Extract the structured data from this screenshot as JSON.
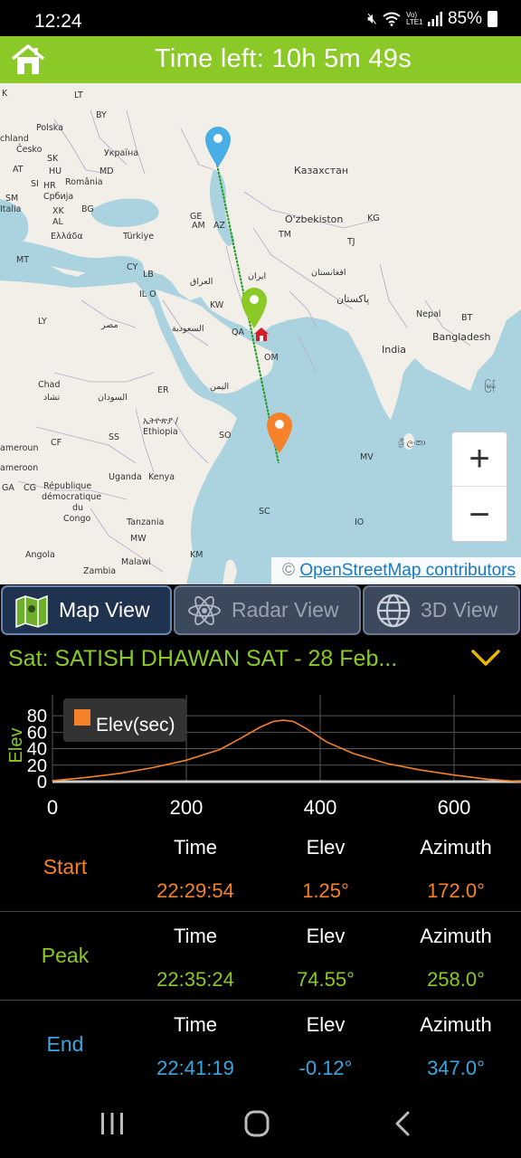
{
  "status": {
    "time": "12:24",
    "signal_label": "Vo) LTE1",
    "battery": "85%"
  },
  "header": {
    "title": "Time left: 10h 5m 49s",
    "home_icon": "home-icon"
  },
  "map": {
    "labels": {
      "polska": "Polska",
      "chland": "chland",
      "cesko": "Česko",
      "sk": "SK",
      "ukraina": "Україна",
      "at": "AT",
      "hu": "HU",
      "md": "MD",
      "si": "SI",
      "hr": "HR",
      "romania": "România",
      "sm": "SM",
      "srbija": "Србија",
      "italia": "Italia",
      "xk": "XK",
      "bg": "BG",
      "al": "AL",
      "ellada": "Ελλάδα",
      "turkiye": "Türkiye",
      "mt": "MT",
      "cy": "CY",
      "lb": "LB",
      "ilo": "IL O",
      "ly": "LY",
      "misr": "مصر",
      "ge": "GE",
      "am": "AM",
      "az": "AZ",
      "kazakhstan": "Казахстан",
      "uzbekiston": "O'zbekiston",
      "kg": "KG",
      "tm": "TM",
      "tj": "TJ",
      "iran": "ایران",
      "iraq": "العراق",
      "afghanistan": "افغانستان",
      "pakistan": "پاکستان",
      "kw": "KW",
      "saudi": "السعودية",
      "qa": "QA",
      "om": "OM",
      "nepal": "Nepal",
      "bt": "BT",
      "bangladesh": "Bangladesh",
      "india": "India",
      "myanmar": "မြန်",
      "lk": "ශ්‍රී ලංකා",
      "chad": "Chad",
      "tchad": "تشاد",
      "sudan": "السودان",
      "er": "ER",
      "yemen": "اليمن",
      "ethiopia_am": "ኢትዮጵያ /",
      "ethiopia": "Ethiopia",
      "so": "SO",
      "ss": "SS",
      "cf": "CF",
      "cameroun": "ameroun",
      "cameroon": "ameroon",
      "ga": "GA",
      "cg": "CG",
      "rdc1": "République",
      "rdc2": "démocratique",
      "rdc3": "du",
      "rdc4": "Congo",
      "uganda": "Uganda",
      "kenya": "Kenya",
      "tanzania": "Tanzania",
      "angola": "Angola",
      "zambia": "Zambia",
      "malawi": "Malawi",
      "mw": "MW",
      "km": "KM",
      "mv": "MV",
      "sc": "SC",
      "io": "IO",
      "by": "BY",
      "lt": "LT",
      "dk": "K"
    },
    "zoom_in": "+",
    "zoom_out": "−",
    "attribution_prefix": "©",
    "attribution_link": "OpenStreetMap contributors"
  },
  "tabs": [
    {
      "label": "Map View",
      "icon": "map-icon",
      "active": true
    },
    {
      "label": "Radar View",
      "icon": "atom-icon",
      "active": false
    },
    {
      "label": "3D View",
      "icon": "globe-icon",
      "active": false
    }
  ],
  "satellite": {
    "label": "Sat: SATISH DHAWAN SAT - 28 Feb..."
  },
  "chart_data": {
    "type": "line",
    "title": "",
    "xlabel": "",
    "ylabel": "Elev",
    "x_ticks": [
      "0",
      "200",
      "400",
      "600"
    ],
    "y_ticks": [
      "0",
      "20",
      "40",
      "60",
      "80"
    ],
    "xlim": [
      0,
      700
    ],
    "ylim": [
      0,
      90
    ],
    "legend_position": "top-left",
    "series": [
      {
        "name": "Elev(sec)",
        "color": "#f5822a",
        "x": [
          0,
          50,
          100,
          150,
          200,
          250,
          280,
          310,
          330,
          345,
          360,
          380,
          410,
          450,
          500,
          550,
          600,
          650,
          700
        ],
        "y": [
          1.25,
          5,
          10,
          17,
          26,
          39,
          52,
          66,
          73,
          74.55,
          73,
          64,
          48,
          34,
          22,
          14,
          8,
          3,
          -0.12
        ]
      }
    ]
  },
  "pass_table": {
    "headers": {
      "time": "Time",
      "elev": "Elev",
      "azimuth": "Azimuth"
    },
    "rows": [
      {
        "name": "Start",
        "time": "22:29:54",
        "elev": "1.25°",
        "azimuth": "172.0°",
        "color": "#f5822a"
      },
      {
        "name": "Peak",
        "time": "22:35:24",
        "elev": "74.55°",
        "azimuth": "258.0°",
        "color": "#8ac926"
      },
      {
        "name": "End",
        "time": "22:41:19",
        "elev": "-0.12°",
        "azimuth": "347.0°",
        "color": "#3aa6e0"
      }
    ]
  },
  "colors": {
    "accent_green": "#8ac926",
    "orange": "#f5822a",
    "blue": "#3aa6e0",
    "track": "#1f9a1f"
  }
}
